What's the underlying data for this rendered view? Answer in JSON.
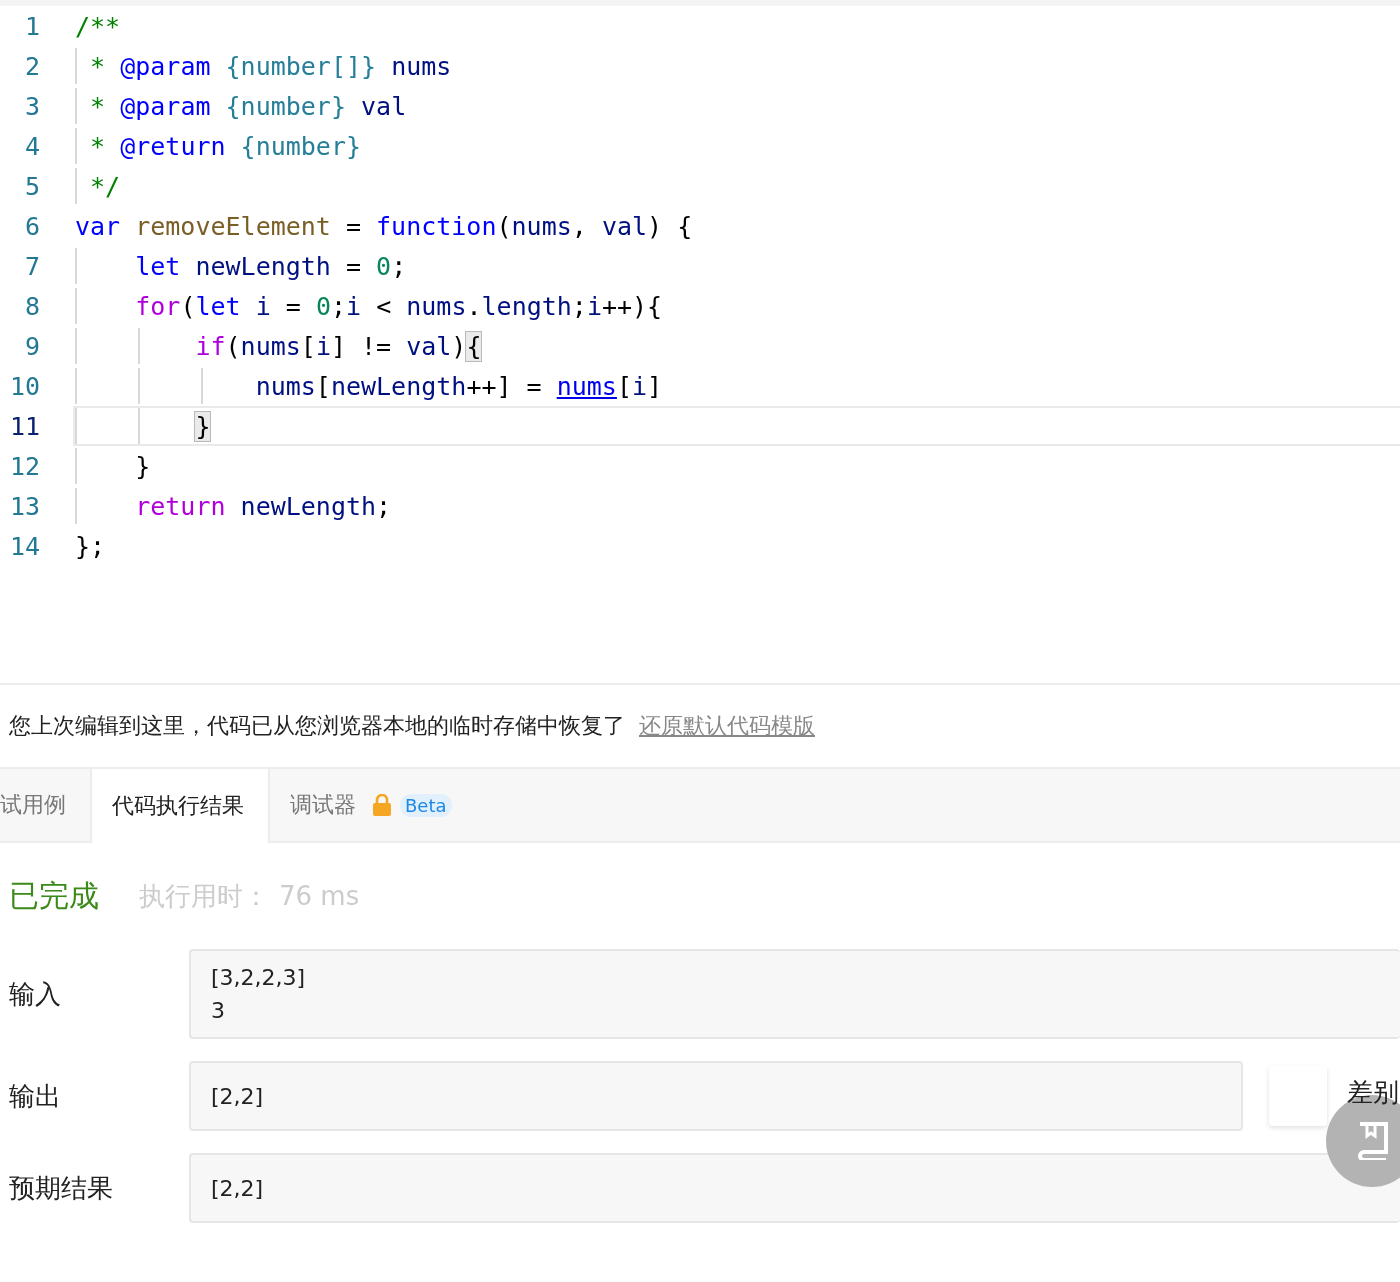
{
  "editor": {
    "lines": [
      {
        "number": "1",
        "current": false,
        "tokens": [
          {
            "text": "/**",
            "kind": "comment"
          }
        ]
      },
      {
        "number": "2",
        "current": false,
        "tokens": [
          {
            "text": " * ",
            "kind": "comment"
          },
          {
            "text": "@param",
            "kind": "tag"
          },
          {
            "text": " {number[]}",
            "kind": "type"
          },
          {
            "text": " nums",
            "kind": "var"
          }
        ]
      },
      {
        "number": "3",
        "current": false,
        "tokens": [
          {
            "text": " * ",
            "kind": "comment"
          },
          {
            "text": "@param",
            "kind": "tag"
          },
          {
            "text": " {number}",
            "kind": "type"
          },
          {
            "text": " val",
            "kind": "var"
          }
        ]
      },
      {
        "number": "4",
        "current": false,
        "tokens": [
          {
            "text": " * ",
            "kind": "comment"
          },
          {
            "text": "@return",
            "kind": "tag"
          },
          {
            "text": " {number}",
            "kind": "type"
          }
        ]
      },
      {
        "number": "5",
        "current": false,
        "tokens": [
          {
            "text": " */",
            "kind": "comment"
          }
        ]
      },
      {
        "number": "6",
        "current": false,
        "tokens": [
          {
            "text": "var",
            "kind": "decl"
          },
          {
            "text": " removeElement",
            "kind": "def"
          },
          {
            "text": " = ",
            "kind": "plain"
          },
          {
            "text": "function",
            "kind": "decl"
          },
          {
            "text": "(",
            "kind": "plain"
          },
          {
            "text": "nums",
            "kind": "var"
          },
          {
            "text": ", ",
            "kind": "plain"
          },
          {
            "text": "val",
            "kind": "var"
          },
          {
            "text": ") {",
            "kind": "plain"
          }
        ]
      },
      {
        "number": "7",
        "current": false,
        "tokens": [
          {
            "text": "    let",
            "kind": "decl"
          },
          {
            "text": " newLength",
            "kind": "var"
          },
          {
            "text": " = ",
            "kind": "plain"
          },
          {
            "text": "0",
            "kind": "num"
          },
          {
            "text": ";",
            "kind": "plain"
          }
        ]
      },
      {
        "number": "8",
        "current": false,
        "tokens": [
          {
            "text": "    for",
            "kind": "keyword"
          },
          {
            "text": "(",
            "kind": "plain"
          },
          {
            "text": "let",
            "kind": "decl"
          },
          {
            "text": " i",
            "kind": "var"
          },
          {
            "text": " = ",
            "kind": "plain"
          },
          {
            "text": "0",
            "kind": "num"
          },
          {
            "text": ";",
            "kind": "plain"
          },
          {
            "text": "i",
            "kind": "var"
          },
          {
            "text": " < ",
            "kind": "plain"
          },
          {
            "text": "nums",
            "kind": "var"
          },
          {
            "text": ".",
            "kind": "plain"
          },
          {
            "text": "length",
            "kind": "var"
          },
          {
            "text": ";",
            "kind": "plain"
          },
          {
            "text": "i",
            "kind": "var"
          },
          {
            "text": "++){",
            "kind": "plain"
          }
        ]
      },
      {
        "number": "9",
        "current": false,
        "tokens": [
          {
            "text": "        if",
            "kind": "keyword"
          },
          {
            "text": "(",
            "kind": "plain"
          },
          {
            "text": "nums",
            "kind": "var"
          },
          {
            "text": "[",
            "kind": "plain"
          },
          {
            "text": "i",
            "kind": "var"
          },
          {
            "text": "] != ",
            "kind": "plain"
          },
          {
            "text": "val",
            "kind": "var"
          },
          {
            "text": ")",
            "kind": "plain"
          },
          {
            "text": "{",
            "kind": "match"
          }
        ]
      },
      {
        "number": "10",
        "current": false,
        "tokens": [
          {
            "text": "            nums",
            "kind": "var"
          },
          {
            "text": "[",
            "kind": "plain"
          },
          {
            "text": "newLength",
            "kind": "var"
          },
          {
            "text": "++] = ",
            "kind": "plain"
          },
          {
            "text": "nums",
            "kind": "link"
          },
          {
            "text": "[",
            "kind": "plain"
          },
          {
            "text": "i",
            "kind": "var"
          },
          {
            "text": "]",
            "kind": "plain"
          }
        ]
      },
      {
        "number": "11",
        "current": true,
        "tokens": [
          {
            "text": "        }",
            "kind": "match"
          }
        ]
      },
      {
        "number": "12",
        "current": false,
        "tokens": [
          {
            "text": "    }",
            "kind": "plain"
          }
        ]
      },
      {
        "number": "13",
        "current": false,
        "tokens": [
          {
            "text": "    return",
            "kind": "keyword"
          },
          {
            "text": " newLength",
            "kind": "var"
          },
          {
            "text": ";",
            "kind": "plain"
          }
        ]
      },
      {
        "number": "14",
        "current": false,
        "tokens": [
          {
            "text": "};",
            "kind": "plain"
          }
        ]
      }
    ]
  },
  "notice": {
    "text": "您上次编辑到这里，代码已从您浏览器本地的临时存储中恢复了",
    "link": "还原默认代码模版"
  },
  "tabs": [
    {
      "label": "试用例",
      "selected": false
    },
    {
      "label": "代码执行结果",
      "selected": true
    },
    {
      "label": "调试器",
      "selected": false,
      "locked": true,
      "badge": "Beta"
    }
  ],
  "result": {
    "status": "已完成",
    "runtime_label": "执行用时：",
    "runtime": "76 ms",
    "rows": [
      {
        "label": "输入",
        "lines": [
          "[3,2,2,3]",
          "3"
        ],
        "kind": "full"
      },
      {
        "label": "输出",
        "lines": [
          "[2,2]"
        ],
        "kind": "diff",
        "button": "差别"
      },
      {
        "label": "预期结果",
        "lines": [
          "[2,2]"
        ],
        "kind": "full"
      }
    ]
  }
}
